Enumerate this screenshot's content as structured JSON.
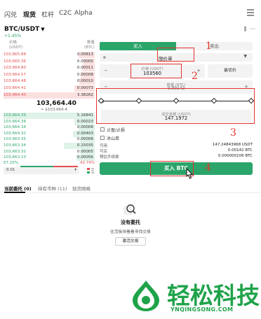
{
  "nav": {
    "tabs": [
      "闪兑",
      "现货",
      "杠杆",
      "C2C",
      "Alpha"
    ],
    "active_tab": "现货"
  },
  "pair": {
    "symbol": "BTC/USDT",
    "change": "+1.45%"
  },
  "orderbook": {
    "price_header": "价格",
    "price_unit": "(USDT)",
    "qty_header": "数量",
    "qty_unit": "(BTC)",
    "asks": [
      {
        "price": "103,665.88",
        "qty": "0.00813",
        "depth": 0.18
      },
      {
        "price": "103,665.36",
        "qty": "0.00005",
        "depth": 0.12
      },
      {
        "price": "103,664.80",
        "qty": "0.00011",
        "depth": 0.14
      },
      {
        "price": "103,664.57",
        "qty": "0.00008",
        "depth": 0.15
      },
      {
        "price": "103,664.48",
        "qty": "0.00010",
        "depth": 0.17
      },
      {
        "price": "103,664.41",
        "qty": "0.00073",
        "depth": 0.22
      },
      {
        "price": "103,664.40",
        "qty": "3.38262",
        "depth": 1.0
      }
    ],
    "mid_price": "103,664.40",
    "mid_fiat": "≈ $103,664.4",
    "bids": [
      {
        "price": "103,664.39",
        "qty": "5.16841",
        "depth": 1.0
      },
      {
        "price": "103,664.38",
        "qty": "0.00023",
        "depth": 0.22
      },
      {
        "price": "103,664.34",
        "qty": "0.00008",
        "depth": 0.18
      },
      {
        "price": "103,664.32",
        "qty": "0.00403",
        "depth": 0.24
      },
      {
        "price": "103,663.35",
        "qty": "0.00008",
        "depth": 0.16
      },
      {
        "price": "103,663.34",
        "qty": "0.15035",
        "depth": 0.34
      },
      {
        "price": "103,663.32",
        "qty": "0.00005",
        "depth": 0.15
      },
      {
        "price": "103,663.23",
        "qty": "0.00056",
        "depth": 0.2
      }
    ],
    "ratio_buy": "57.25%",
    "ratio_sell": "42.74%",
    "buy_fraction": 0.5725,
    "depth_value": "0.01"
  },
  "trade": {
    "buy_tab": "买入",
    "sell_tab": "卖出",
    "order_type": "限价单",
    "price_label": "价格 (USDT)",
    "price_value": "103560",
    "best_price": "最优价",
    "amount_label": "数量 (BTC)",
    "amount_value": "0.00142",
    "total_label": "成交金额 (USDT)",
    "total_value": "147.1972",
    "slider_marks": 5,
    "tp_sl": "止盈/止损",
    "iceberg": "冰山单",
    "available_label": "可用",
    "available_value": "147.24843968 USDT",
    "can_buy_label": "可买",
    "can_buy_value": "0.00142 BTC",
    "fee_label": "预估手续费",
    "fee_value": "0.000000106 BTC",
    "buy_button": "买入 BTC"
  },
  "annotations": [
    "1",
    "2",
    "3",
    "4"
  ],
  "colors": {
    "green": "#2ba56a",
    "red": "#e34c4c",
    "annotation": "#e2332b"
  },
  "bottom": {
    "tabs": [
      "当前委托 (0)",
      "持有币种 (11)",
      "现货网格"
    ],
    "empty_title": "没有委托",
    "empty_sub": "往活板块看看寻找交易",
    "deposit_button": "激活交易"
  },
  "watermark": {
    "text": "轻松科技",
    "sub": "YNQINGSONG.COM"
  }
}
